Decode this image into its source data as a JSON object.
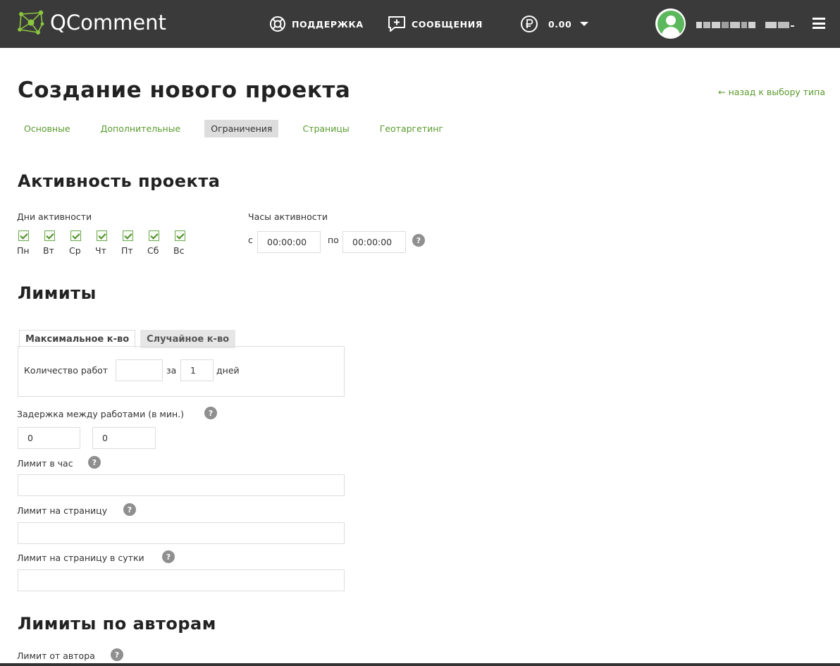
{
  "header": {
    "logo_text": "QComment",
    "support_label": "ПОДДЕРЖКА",
    "messages_label": "СООБЩЕНИЯ",
    "balance": "0.00",
    "icons": [
      "qcomment-logo-icon",
      "lifebuoy-icon",
      "message-plus-icon",
      "ruble-icon",
      "chevron-down-icon",
      "user-avatar-icon",
      "menu-icon"
    ]
  },
  "page": {
    "title": "Создание нового проекта",
    "back_link": "← назад к выбору типа",
    "tabs": [
      "Основные",
      "Дополнительные",
      "Ограничения",
      "Страницы",
      "Геотаргетинг"
    ],
    "active_tab": "Ограничения"
  },
  "activity": {
    "heading": "Активность проекта",
    "days_label": "Дни активности",
    "days": [
      "Пн",
      "Вт",
      "Ср",
      "Чт",
      "Пт",
      "Сб",
      "Вс"
    ],
    "days_checked": [
      true,
      true,
      true,
      true,
      true,
      true,
      true
    ],
    "hours_label": "Часы активности",
    "from_label": "с",
    "from_value": "00:00:00",
    "to_label": "по",
    "to_value": "00:00:00"
  },
  "limits": {
    "heading": "Лимиты",
    "subtab_max": "Максимальное к-во",
    "subtab_random": "Случайное к-во",
    "works_label": "Количество работ",
    "works_value": "",
    "for_label": "за",
    "days_value": "1",
    "days_unit": "дней",
    "delay_label": "Задержка между работами (в мин.)",
    "delay_min": "0",
    "delay_max": "0",
    "hour_limit_label": "Лимит в час",
    "hour_limit_value": "",
    "page_limit_label": "Лимит на страницу",
    "page_limit_value": "",
    "page_day_limit_label": "Лимит на страницу в сутки",
    "page_day_limit_value": ""
  },
  "author_limits": {
    "heading": "Лимиты по авторам",
    "author_limit_label": "Лимит от автора"
  },
  "help_glyph": "?",
  "colors": {
    "header_bg": "#3a3a3a",
    "link_green": "#5a9a2e",
    "checkbox_green": "#6aa84f",
    "avatar_green": "#5cb85c",
    "help_gray": "#8f8f8f"
  }
}
